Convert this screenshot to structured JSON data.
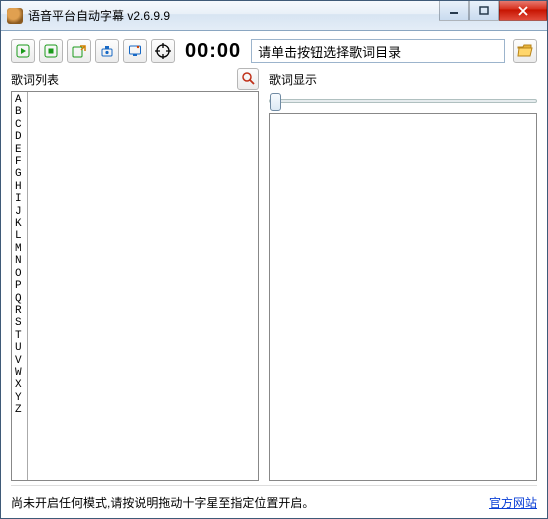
{
  "window": {
    "title": "语音平台自动字幕  v2.6.9.9"
  },
  "toolbar": {
    "timer": "00:00",
    "path_value": "请单击按钮选择歌词目录",
    "icons": {
      "play": "play-icon",
      "stop": "stop-icon",
      "export": "export-icon",
      "record": "record-icon",
      "screen": "screen-icon",
      "target": "target-icon",
      "open": "folder-open-icon"
    }
  },
  "left_panel": {
    "title": "歌词列表",
    "search_icon": "search-icon",
    "alphabet": "A\nB\nC\nD\nE\nF\nG\nH\nI\nJ\nK\nL\nM\nN\nO\nP\nQ\nR\nS\nT\nU\nV\nW\nX\nY\nZ"
  },
  "right_panel": {
    "title": "歌词显示"
  },
  "status": {
    "message": "尚未开启任何模式,请按说明拖动十字星至指定位置开启。",
    "link_text": "官方网站"
  },
  "colors": {
    "accent_green": "#1a9a1a",
    "accent_blue": "#1768c4",
    "close_red": "#d62c1a",
    "link_blue": "#0a3fd6"
  }
}
